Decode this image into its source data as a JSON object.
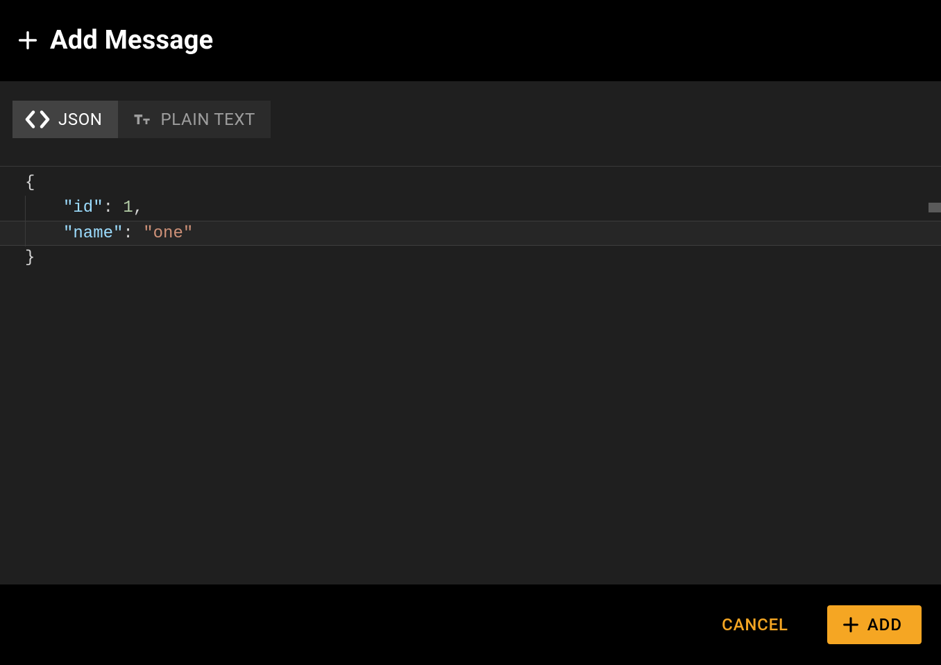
{
  "header": {
    "title": "Add Message"
  },
  "tabs": {
    "json_label": "JSON",
    "plain_label": "PLAIN TEXT"
  },
  "editor": {
    "key_id": "\"id\"",
    "val_id": "1",
    "key_name": "\"name\"",
    "val_name": "\"one\"",
    "open_brace": "{",
    "close_brace": "}",
    "colon": ":",
    "comma": ","
  },
  "footer": {
    "cancel_label": "CANCEL",
    "add_label": "ADD"
  }
}
